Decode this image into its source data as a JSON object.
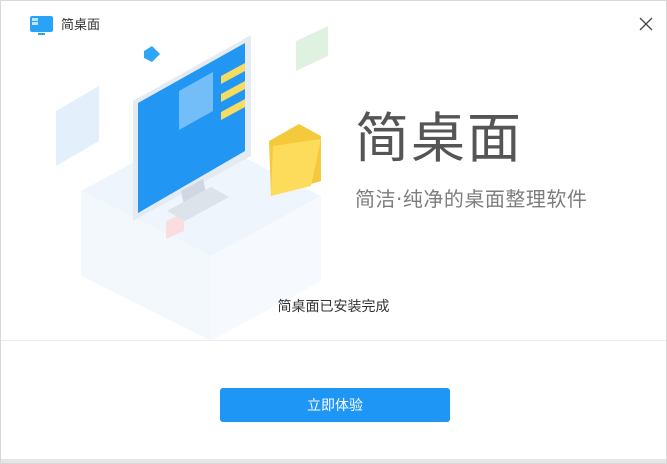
{
  "window": {
    "title": "简桌面",
    "close_icon": "close-icon",
    "app_icon": "monitor-icon"
  },
  "hero": {
    "title": "简桌面",
    "subtitle": "简洁·纯净的桌面整理软件"
  },
  "status": {
    "text": "简桌面已安装完成"
  },
  "actions": {
    "primary_label": "立即体验"
  },
  "colors": {
    "accent": "#1e96f5",
    "title_text": "#555555",
    "subtitle_text": "#7d7d7d"
  }
}
